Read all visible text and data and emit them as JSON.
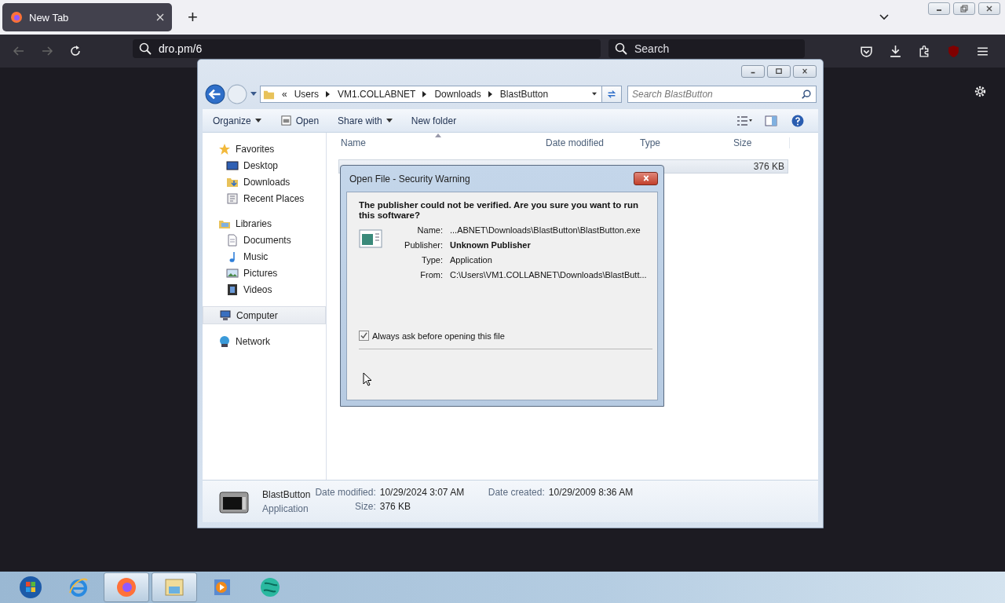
{
  "browser": {
    "tabs": [
      {
        "title": "New Tab",
        "selected": true
      }
    ],
    "new_tab": "+",
    "address": {
      "value": "dro.pm/6"
    },
    "search": {
      "placeholder": "Search"
    }
  },
  "explorer": {
    "breadcrumb": [
      "Users",
      "VM1.COLLABNET",
      "Downloads",
      "BlastButton"
    ],
    "overflow": "«",
    "search": {
      "placeholder": "Search BlastButton"
    },
    "commands": [
      {
        "label": "Organize",
        "dropdown": true,
        "icon": false
      },
      {
        "label": "Open",
        "dropdown": false,
        "icon": true
      },
      {
        "label": "Share with",
        "dropdown": true,
        "icon": false
      },
      {
        "label": "New folder",
        "dropdown": false,
        "icon": false
      }
    ],
    "nav": [
      {
        "label": "Favorites",
        "kind": "star",
        "selected": false,
        "children": [
          {
            "label": "Desktop",
            "kind": "desktop",
            "selected": false
          },
          {
            "label": "Downloads",
            "kind": "downloads",
            "selected": false
          },
          {
            "label": "Recent Places",
            "kind": "recent",
            "selected": false
          }
        ]
      },
      {
        "label": "Libraries",
        "kind": "library",
        "selected": false,
        "children": [
          {
            "label": "Documents",
            "kind": "document",
            "selected": false
          },
          {
            "label": "Music",
            "kind": "music",
            "selected": false
          },
          {
            "label": "Pictures",
            "kind": "pictures",
            "selected": false
          },
          {
            "label": "Videos",
            "kind": "video",
            "selected": false
          }
        ]
      },
      {
        "label": "Computer",
        "kind": "computer",
        "selected": true
      },
      {
        "label": "Network",
        "kind": "network",
        "selected": false
      }
    ],
    "columns": [
      "Name",
      "Date modified",
      "Type",
      "Size"
    ],
    "rows": [
      {
        "size": "376 KB",
        "selected": true
      }
    ],
    "details": {
      "name": "BlastButton",
      "type": "Application",
      "columns": [
        [
          {
            "label": "Date modified:",
            "value": "10/29/2024 3:07 AM"
          },
          {
            "label": "Size:",
            "value": "376 KB"
          }
        ],
        [
          {
            "label": "Date created:",
            "value": "10/29/2009 8:36 AM"
          }
        ]
      ]
    }
  },
  "dialog": {
    "title": "Open File - Security Warning",
    "heading": "The publisher could not be verified.  Are you sure you want to run this software?",
    "fields": [
      {
        "label": "Name:",
        "value": "...ABNET\\Downloads\\BlastButton\\BlastButton.exe",
        "emphasis": false
      },
      {
        "label": "Publisher:",
        "value": "Unknown Publisher",
        "emphasis": true
      },
      {
        "label": "Type:",
        "value": "Application",
        "emphasis": false
      },
      {
        "label": "From:",
        "value": "C:\\Users\\VM1.COLLABNET\\Downloads\\BlastButt...",
        "emphasis": false
      }
    ],
    "checkbox": {
      "label": "Always ask before opening this file",
      "checked": true
    }
  },
  "taskbar": {
    "apps": [
      {
        "kind": "start",
        "running": false
      },
      {
        "kind": "ie",
        "running": false
      },
      {
        "kind": "firefox",
        "running": true
      },
      {
        "kind": "explorer",
        "running": true
      },
      {
        "kind": "media",
        "running": false
      },
      {
        "kind": "globe",
        "running": false
      }
    ]
  }
}
